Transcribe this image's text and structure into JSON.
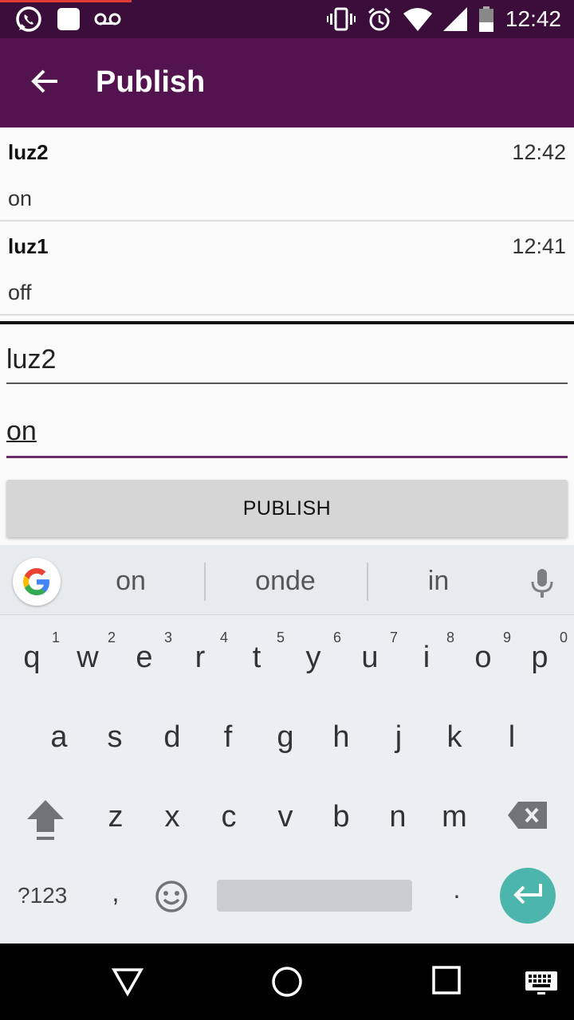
{
  "status_bar": {
    "time": "12:42",
    "left_icons": [
      "whatsapp-icon",
      "notification-square-icon",
      "voicemail-icon"
    ],
    "right_icons": [
      "vibrate-icon",
      "alarm-icon",
      "wifi-icon",
      "signal-icon",
      "battery-icon"
    ]
  },
  "app_bar": {
    "title": "Publish",
    "back_icon": "arrow-left-icon"
  },
  "messages": [
    {
      "topic": "luz2",
      "time": "12:42",
      "payload": "on"
    },
    {
      "topic": "luz1",
      "time": "12:41",
      "payload": "off"
    }
  ],
  "form": {
    "topic_value": "luz2",
    "payload_value": "on",
    "publish_label": "PUBLISH"
  },
  "keyboard": {
    "suggestions": [
      "on",
      "onde",
      "in"
    ],
    "row1": [
      {
        "k": "q",
        "n": "1"
      },
      {
        "k": "w",
        "n": "2"
      },
      {
        "k": "e",
        "n": "3"
      },
      {
        "k": "r",
        "n": "4"
      },
      {
        "k": "t",
        "n": "5"
      },
      {
        "k": "y",
        "n": "6"
      },
      {
        "k": "u",
        "n": "7"
      },
      {
        "k": "i",
        "n": "8"
      },
      {
        "k": "o",
        "n": "9"
      },
      {
        "k": "p",
        "n": "0"
      }
    ],
    "row2": [
      "a",
      "s",
      "d",
      "f",
      "g",
      "h",
      "j",
      "k",
      "l"
    ],
    "row3": [
      "z",
      "x",
      "c",
      "v",
      "b",
      "n",
      "m"
    ],
    "symbols_label": "?123",
    "comma_label": ",",
    "period_label": ".",
    "accent_color": "#4db6ac"
  },
  "colors": {
    "app_bar": "#52134f",
    "status_bar": "#3a0d3a",
    "input_focus": "#6d2a69"
  }
}
